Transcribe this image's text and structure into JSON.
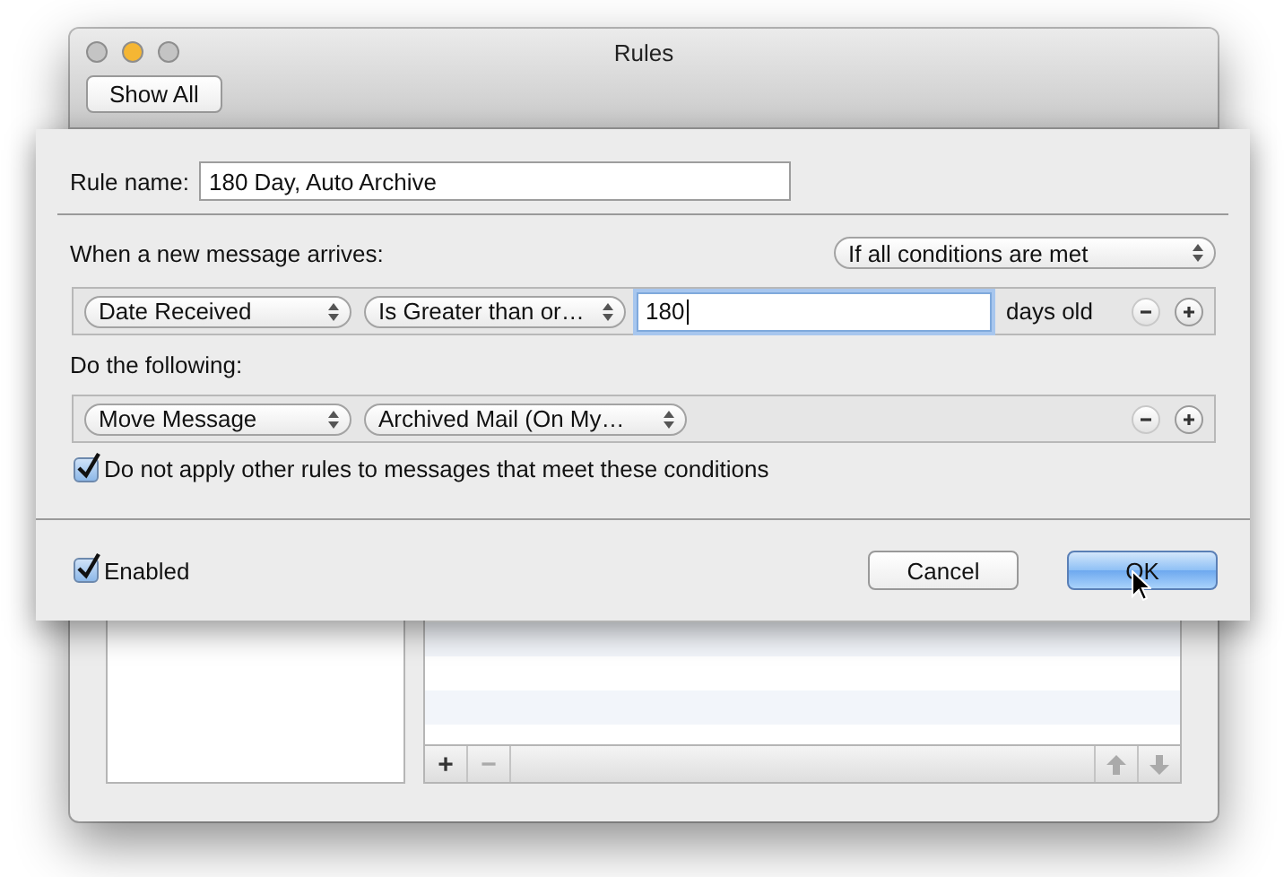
{
  "window": {
    "title": "Rules",
    "toolbar_button": "Show All"
  },
  "sheet": {
    "rule_name_label": "Rule name:",
    "rule_name": "180 Day, Auto Archive",
    "trigger_label": "When a new message arrives:",
    "match_popup": "If all conditions are met",
    "conditions": [
      {
        "field": "Date Received",
        "operator": "Is Greater than or…",
        "value": "180",
        "unit": "days old",
        "remove_disabled": true
      }
    ],
    "actions_label": "Do the following:",
    "actions": [
      {
        "action": "Move Message",
        "target": "Archived Mail (On My…",
        "remove_disabled": true
      }
    ],
    "stop_rules": {
      "label": "Do not apply other rules to messages that meet these conditions",
      "checked": true
    },
    "enabled": {
      "label": "Enabled",
      "checked": true
    },
    "buttons": [
      {
        "label": "Cancel",
        "default": false
      },
      {
        "label": "OK",
        "default": true
      }
    ]
  },
  "rules_toolbar": {
    "add": "+",
    "remove": "−"
  }
}
